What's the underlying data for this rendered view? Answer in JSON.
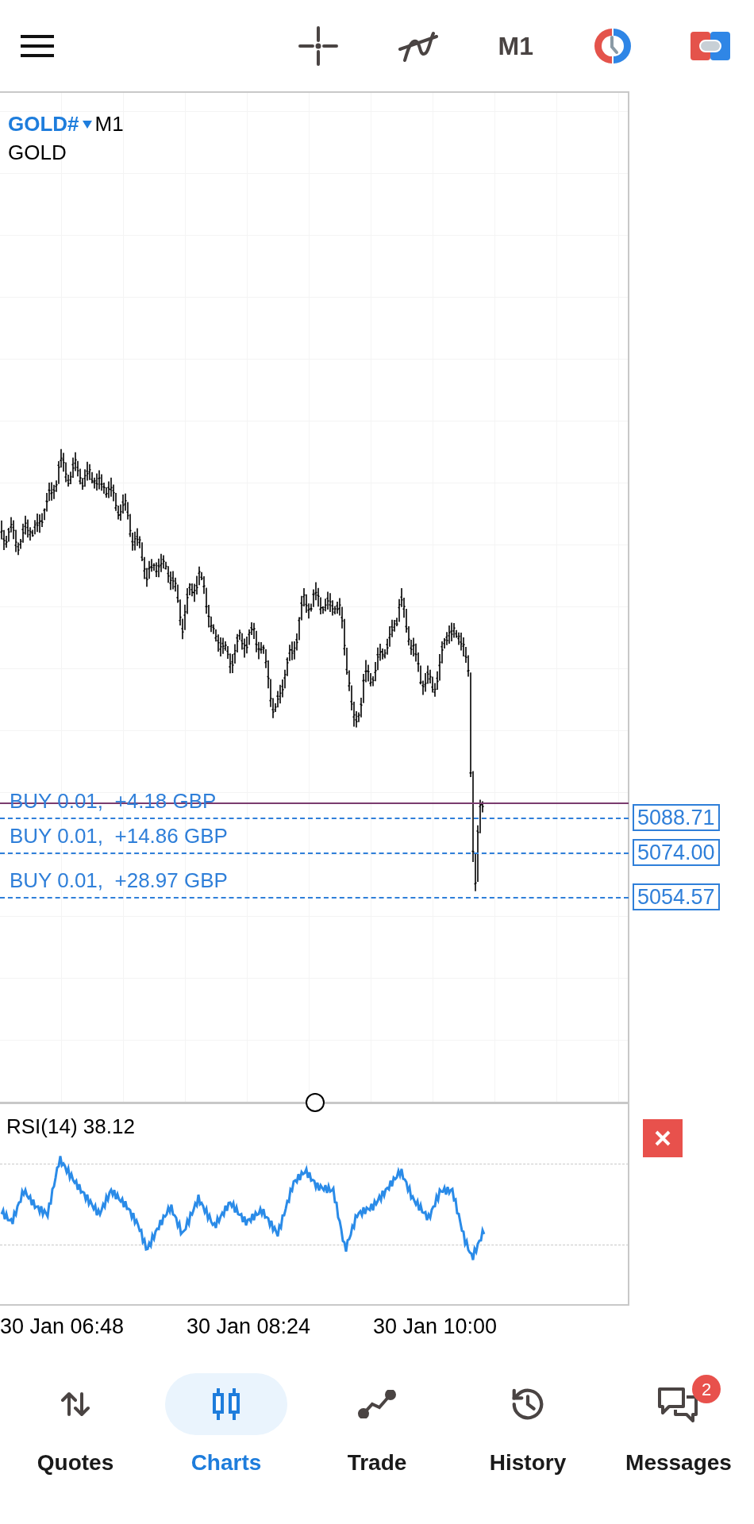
{
  "toolbar": {
    "timeframe": "M1"
  },
  "chart": {
    "symbol": "GOLD#",
    "period": "M1",
    "description": "GOLD",
    "orders": [
      {
        "label": "BUY 0.01,  +4.18 GBP",
        "price": "5088.71"
      },
      {
        "label": "BUY 0.01,  +14.86 GBP",
        "price": "5074.00"
      },
      {
        "label": "BUY 0.01,  +28.97 GBP",
        "price": "5054.57"
      }
    ]
  },
  "indicator": {
    "label": "RSI(14) 38.12"
  },
  "time_axis": [
    "30 Jan 06:48",
    "30 Jan 08:24",
    "30 Jan 10:00"
  ],
  "nav": [
    {
      "kind": "quotes",
      "label": "Quotes",
      "selected": false
    },
    {
      "kind": "charts",
      "label": "Charts",
      "selected": true
    },
    {
      "kind": "trade",
      "label": "Trade",
      "selected": false
    },
    {
      "kind": "history",
      "label": "History",
      "selected": false
    },
    {
      "kind": "messages",
      "label": "Messages",
      "selected": false,
      "badge": "2"
    }
  ]
}
